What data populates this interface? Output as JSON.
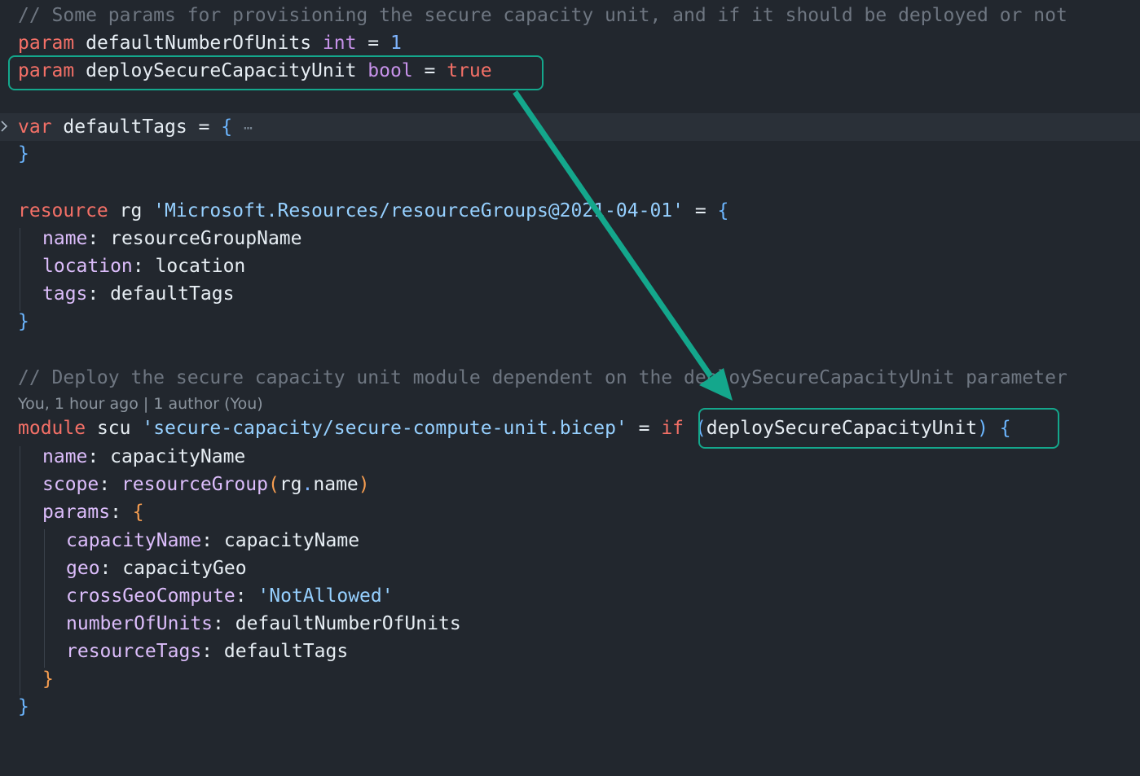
{
  "accent_color": "#14a78c",
  "lines": {
    "l1_comment": "// Some params for provisioning the secure capacity unit, and if it should be deployed or not",
    "l2": {
      "kw": "param",
      "name": " defaultNumberOfUnits ",
      "type": "int",
      "eq": " = ",
      "val": "1"
    },
    "l3": {
      "kw": "param",
      "name": " deploySecureCapacityUnit ",
      "type": "bool",
      "eq": " = ",
      "val": "true"
    },
    "l5": {
      "kw": "var",
      "name": " defaultTags = ",
      "brace": "{",
      "ellipsis": "⋯"
    },
    "l6": {
      "brace": "}"
    },
    "l8": {
      "kw": "resource",
      "name": " rg ",
      "str": "'Microsoft.Resources/resourceGroups@2021-04-01'",
      "eq": " = ",
      "brace": "{"
    },
    "l9": {
      "prop": "name",
      "colon": ": ",
      "val": "resourceGroupName"
    },
    "l10": {
      "prop": "location",
      "colon": ": ",
      "val": "location"
    },
    "l11": {
      "prop": "tags",
      "colon": ": ",
      "val": "defaultTags"
    },
    "l12": {
      "brace": "}"
    },
    "l14_comment": "// Deploy the secure capacity unit module dependent on the deploySecureCapacityUnit parameter",
    "blame": "You, 1 hour ago | 1 author (You)",
    "l15": {
      "kw": "module",
      "name": " scu ",
      "str": "'secure-capacity/secure-compute-unit.bicep'",
      "eq": " = ",
      "if": "if",
      "paren_open": " (",
      "cond": "deploySecureCapacityUnit",
      "paren_close": ")",
      "brace": " {"
    },
    "l16": {
      "prop": "name",
      "colon": ": ",
      "val": "capacityName"
    },
    "l17": {
      "prop": "scope",
      "colon": ": ",
      "func": "resourceGroup",
      "po": "(",
      "obj": "rg",
      "dot": ".",
      "member": "name",
      "pc": ")"
    },
    "l18": {
      "prop": "params",
      "colon": ": ",
      "brace": "{"
    },
    "l19": {
      "prop": "capacityName",
      "colon": ": ",
      "val": "capacityName"
    },
    "l20": {
      "prop": "geo",
      "colon": ": ",
      "val": "capacityGeo"
    },
    "l21": {
      "prop": "crossGeoCompute",
      "colon": ": ",
      "str": "'NotAllowed'"
    },
    "l22": {
      "prop": "numberOfUnits",
      "colon": ": ",
      "val": "defaultNumberOfUnits"
    },
    "l23": {
      "prop": "resourceTags",
      "colon": ": ",
      "val": "defaultTags"
    },
    "l24": {
      "brace": "}"
    },
    "l25": {
      "brace": "}"
    }
  }
}
